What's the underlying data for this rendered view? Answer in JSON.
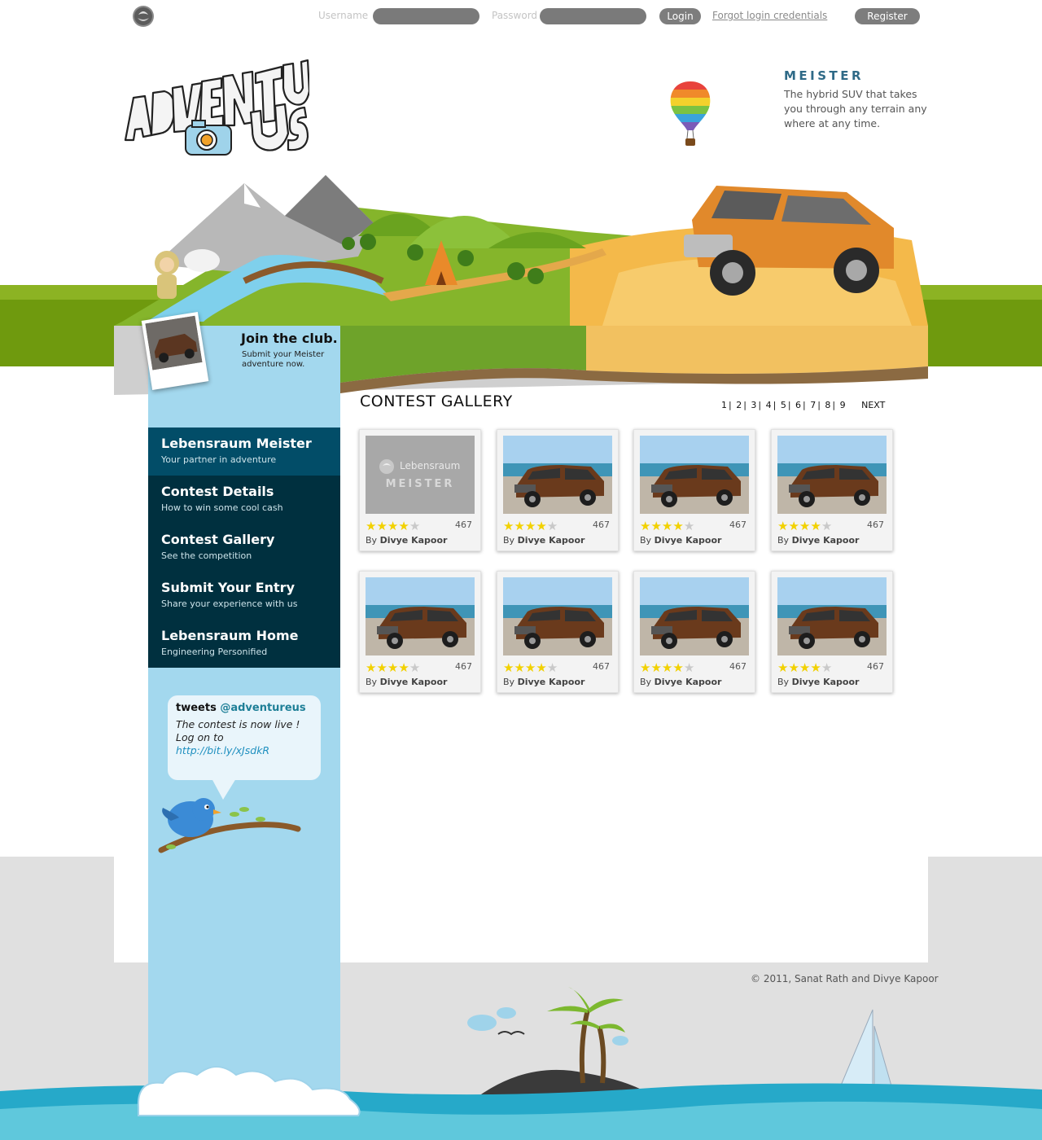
{
  "topbar": {
    "username_label": "Username",
    "password_label": "Password",
    "login_label": "Login",
    "forgot_label": "Forgot  login credentials",
    "register_label": "Register"
  },
  "promo": {
    "title": "MEISTER",
    "text": "The hybrid SUV that takes you through any terrain any where at any time."
  },
  "join": {
    "title": "Join the club.",
    "text": "Submit your Meister adventure now."
  },
  "nav": [
    {
      "title": "Lebensraum Meister",
      "sub": "Your partner in adventure"
    },
    {
      "title": "Contest Details",
      "sub": "How to win some cool cash"
    },
    {
      "title": "Contest Gallery",
      "sub": "See the competition"
    },
    {
      "title": "Submit Your Entry",
      "sub": "Share your experience with us"
    },
    {
      "title": "Lebensraum Home",
      "sub": "Engineering Personified"
    }
  ],
  "tweets": {
    "prefix": "tweets",
    "handle": "@adventureus",
    "message": "The contest is now live ! Log on to",
    "link": "http://bit.ly/xJsdkR"
  },
  "gallery": {
    "title": "CONTEST GALLERY",
    "pages": [
      "1",
      "2",
      "3",
      "4",
      "5",
      "6",
      "7",
      "8",
      "9"
    ],
    "next_label": "NEXT",
    "by_label": "By",
    "placeholder_brand": "Lebensraum",
    "placeholder_name": "MEISTER",
    "entries": [
      {
        "author": "Divye Kapoor",
        "votes": "467",
        "rating": 4,
        "placeholder": true
      },
      {
        "author": "Divye Kapoor",
        "votes": "467",
        "rating": 4,
        "placeholder": false
      },
      {
        "author": "Divye Kapoor",
        "votes": "467",
        "rating": 4,
        "placeholder": false
      },
      {
        "author": "Divye Kapoor",
        "votes": "467",
        "rating": 4,
        "placeholder": false
      },
      {
        "author": "Divye Kapoor",
        "votes": "467",
        "rating": 4,
        "placeholder": false
      },
      {
        "author": "Divye Kapoor",
        "votes": "467",
        "rating": 4,
        "placeholder": false
      },
      {
        "author": "Divye Kapoor",
        "votes": "467",
        "rating": 4,
        "placeholder": false
      },
      {
        "author": "Divye Kapoor",
        "votes": "467",
        "rating": 4,
        "placeholder": false
      }
    ]
  },
  "footer": {
    "copyright": "© 2011, Sanat Rath and Divye Kapoor"
  },
  "colors": {
    "nav_dark": "#00303f",
    "nav_active": "#024d68",
    "panel_blue": "#a3d8ee",
    "star": "#f2d100",
    "grass": "#6f9a0e"
  }
}
